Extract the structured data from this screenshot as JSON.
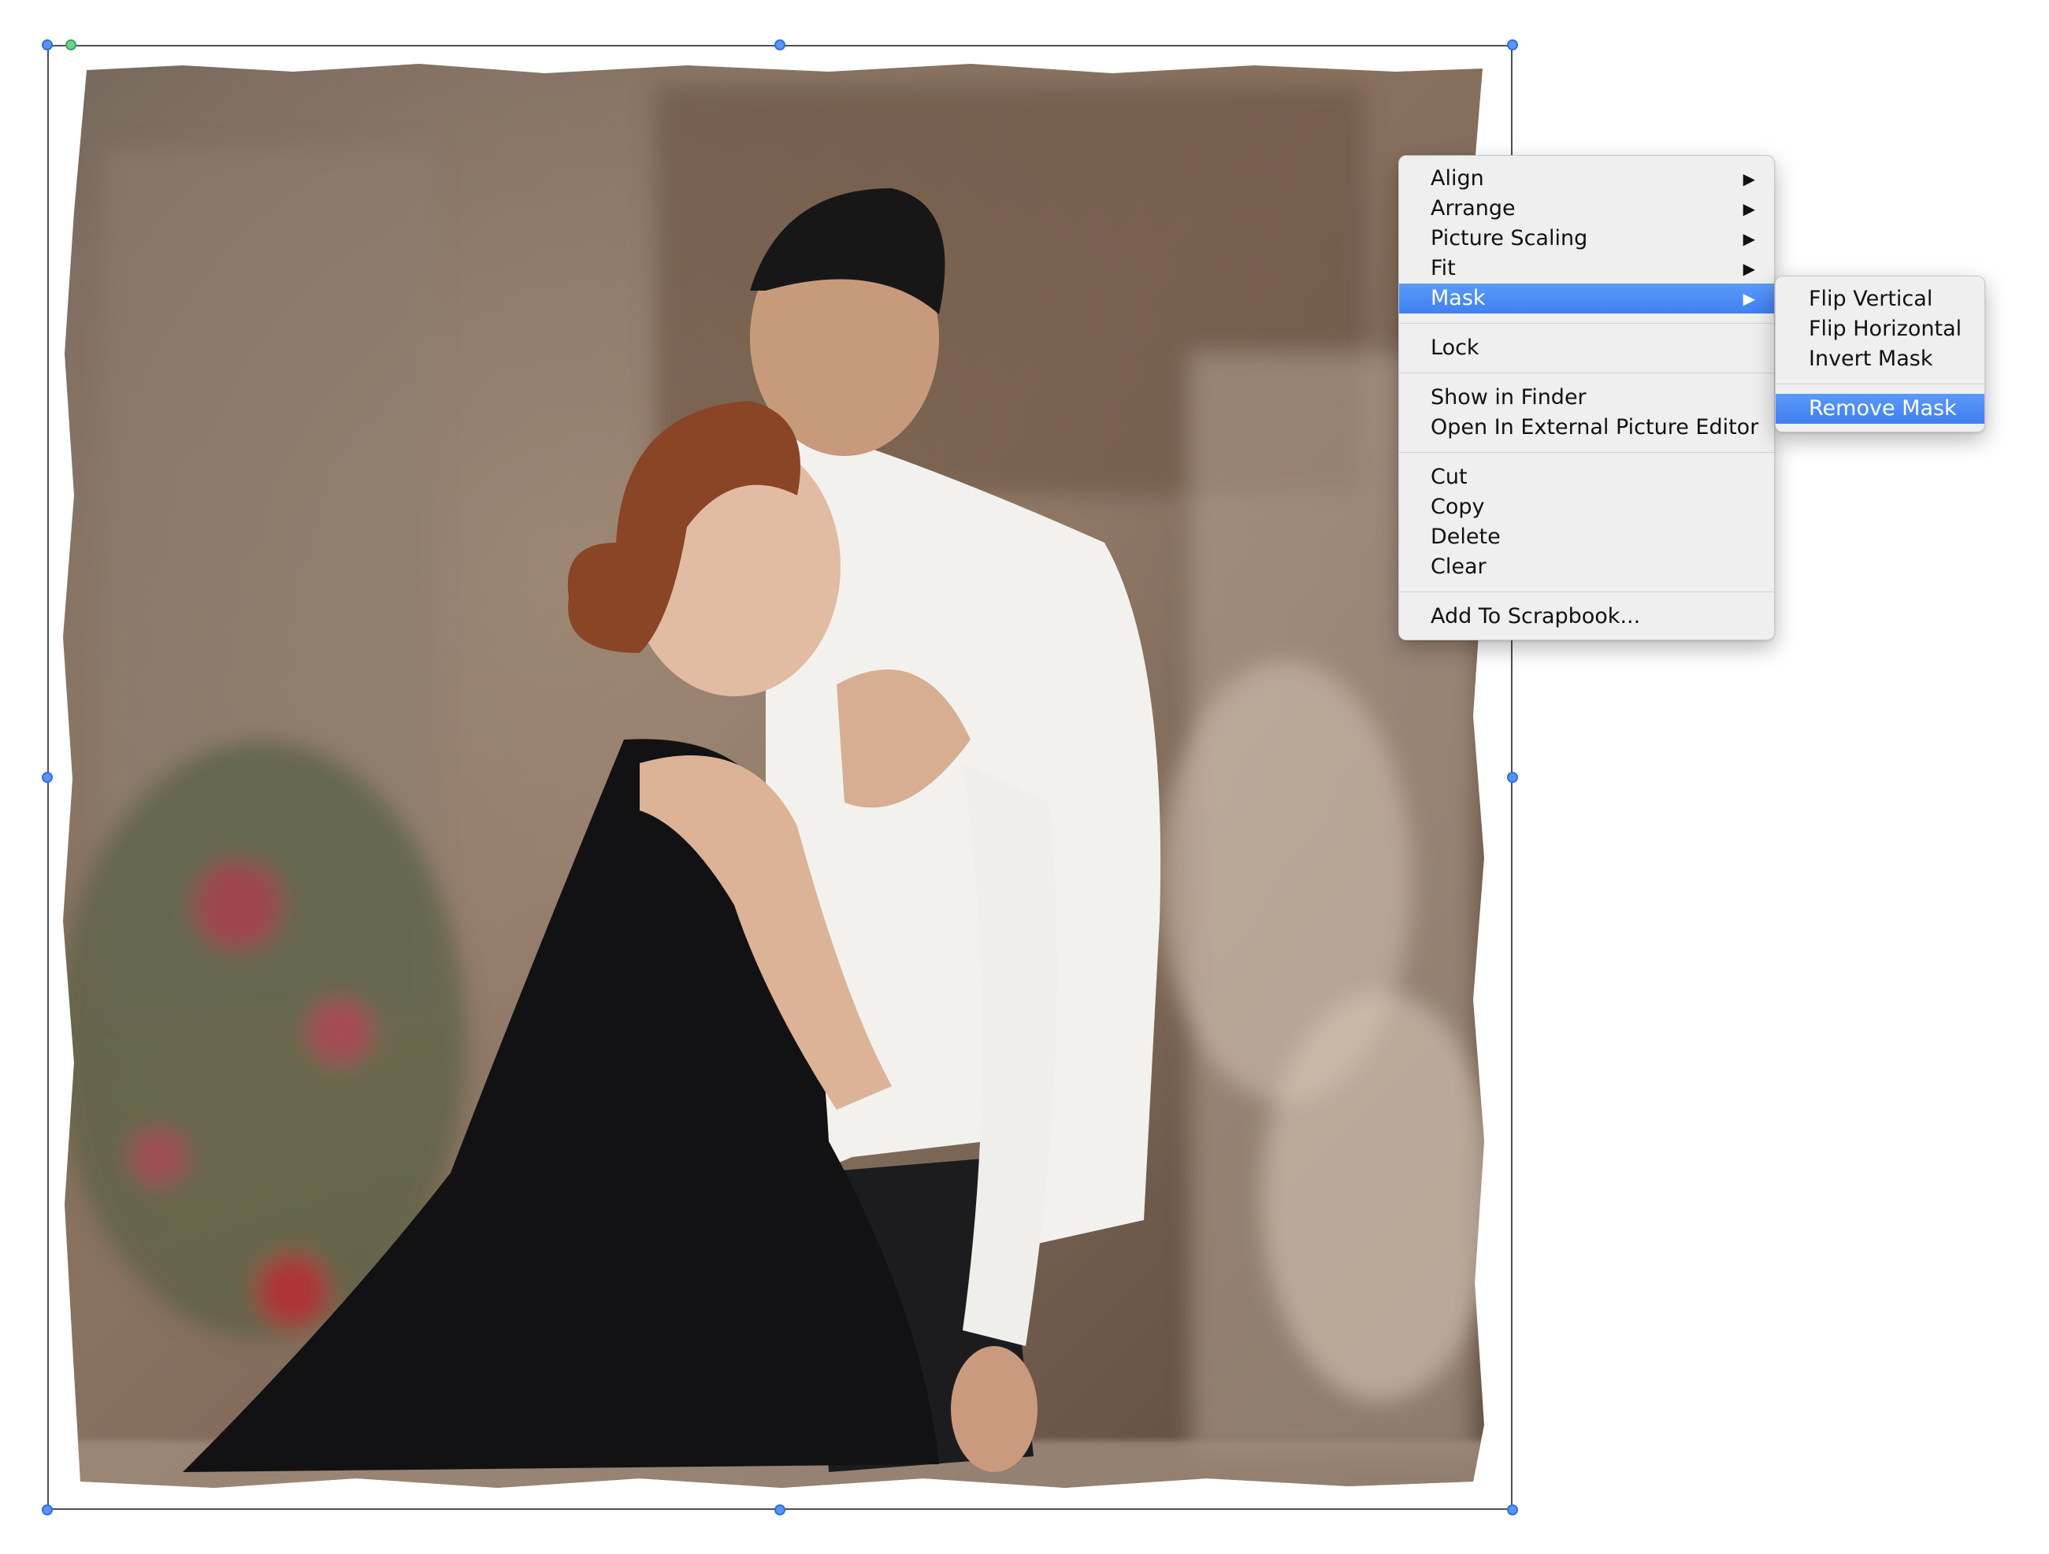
{
  "picture": {
    "description_icon": "masked-photo-couple"
  },
  "context_menu": {
    "groups": [
      [
        {
          "label": "Align",
          "submenu": true
        },
        {
          "label": "Arrange",
          "submenu": true
        },
        {
          "label": "Picture Scaling",
          "submenu": true
        },
        {
          "label": "Fit",
          "submenu": true
        },
        {
          "label": "Mask",
          "submenu": true,
          "highlighted": true
        }
      ],
      [
        {
          "label": "Lock"
        }
      ],
      [
        {
          "label": "Show in Finder"
        },
        {
          "label": "Open In External Picture Editor"
        }
      ],
      [
        {
          "label": "Cut"
        },
        {
          "label": "Copy"
        },
        {
          "label": "Delete"
        },
        {
          "label": "Clear"
        }
      ],
      [
        {
          "label": "Add To Scrapbook..."
        }
      ]
    ],
    "arrow_glyph": "▶"
  },
  "mask_submenu": {
    "groups": [
      [
        {
          "label": "Flip Vertical"
        },
        {
          "label": "Flip Horizontal"
        },
        {
          "label": "Invert Mask"
        }
      ],
      [
        {
          "label": "Remove Mask",
          "highlighted": true
        }
      ]
    ]
  },
  "colors": {
    "highlight": "#4f8ef7",
    "handle": "#5a95f5",
    "rotate_handle": "#6fd18a"
  }
}
